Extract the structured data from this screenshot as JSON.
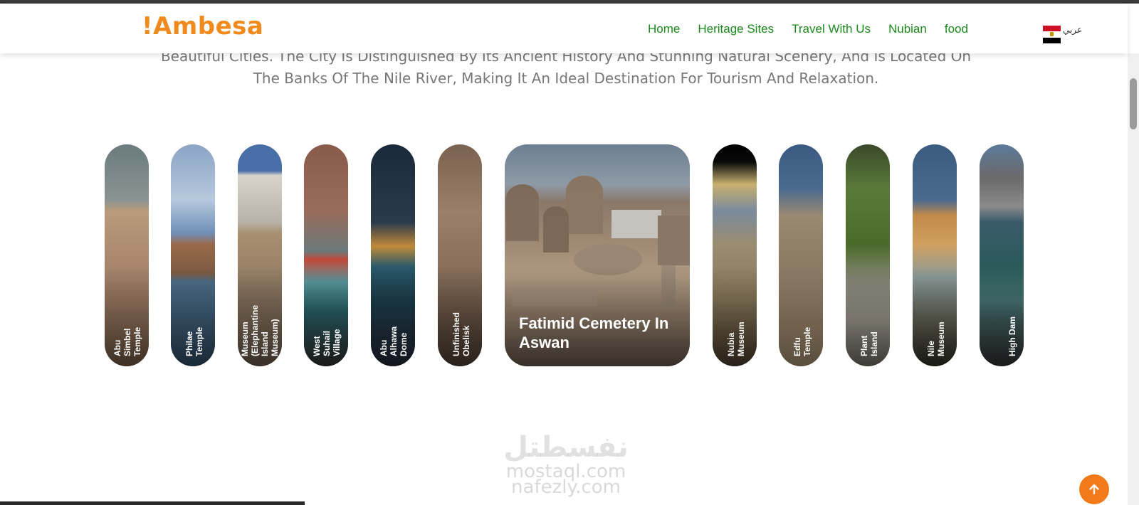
{
  "brand": {
    "logo": "!Ambesa"
  },
  "nav": {
    "items": [
      "Home",
      "Heritage Sites",
      "Travel With Us",
      "Nubian",
      "food"
    ],
    "lang_label": "عربي"
  },
  "intro": {
    "line1": "Beautiful Cities. The City Is Distinguished By Its Ancient History And Stunning Natural Scenery, And Is Located On",
    "line2": "The Banks Of The Nile River, Making It An Ideal Destination For Tourism And Relaxation."
  },
  "cards": [
    {
      "label": "Abu\nSimbel\nTemple"
    },
    {
      "label": "Philae\nTemple"
    },
    {
      "label": "Museum\n(Elephantine\nIsland\nMuseum)"
    },
    {
      "label": "West\nSuhail\nVillage"
    },
    {
      "label": "Abu\nAlhawa\nDome"
    },
    {
      "label": "Unfinished\nObelisk"
    },
    {
      "label": "Fatimid Cemetery In Aswan"
    },
    {
      "label": "Nubia\nMuseum"
    },
    {
      "label": "Edfu\nTemple"
    },
    {
      "label": "Plant\nIsland"
    },
    {
      "label": "Nile\nMuseum"
    },
    {
      "label": "High Dam"
    }
  ],
  "watermark": {
    "arabic": "نفسطتل",
    "line1": "mostaql.com",
    "line2": "nafezly.com"
  },
  "colors": {
    "brand_orange": "#f08a1c",
    "nav_green": "#1a8a1a",
    "to_top": "#f27a1a"
  },
  "icons": {
    "to_top": "arrow-up-icon",
    "flag": "egypt-flag-icon"
  }
}
